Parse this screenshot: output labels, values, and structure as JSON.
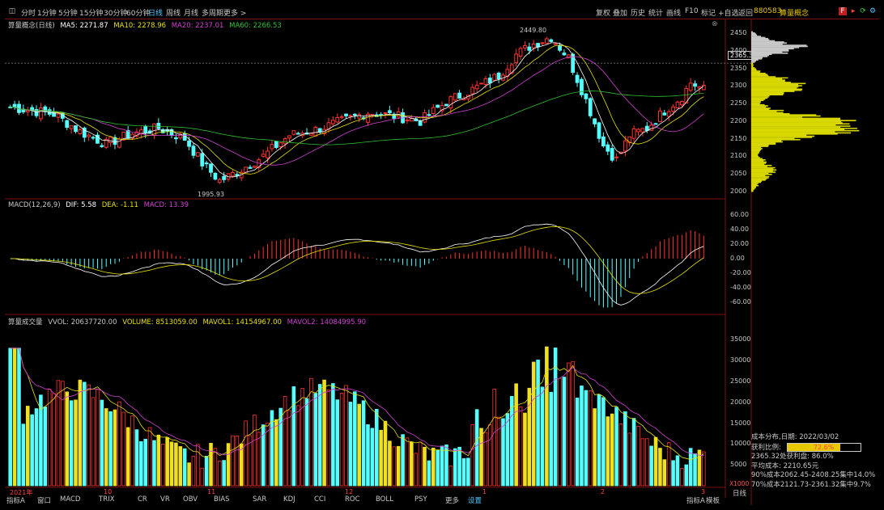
{
  "toolbar": {
    "periods": [
      "分时",
      "1分钟",
      "5分钟",
      "15分钟",
      "30分钟",
      "60分钟",
      "日线",
      "周线",
      "月线",
      "多周期",
      "更多 >"
    ],
    "active_period": "日线",
    "right_buttons": [
      "复权",
      "叠加",
      "历史",
      "统计",
      "画线",
      "F10",
      "标记",
      "+自选",
      "返回"
    ],
    "stock_code": "880583",
    "stock_name": "算量概念"
  },
  "main_chart": {
    "title": "算量概念(日线)",
    "ma5": "MA5: 2271.87",
    "ma10": "MA10: 2278.96",
    "ma20": "MA20: 2237.01",
    "ma60": "MA60: 2266.53",
    "high_label": "2449.80",
    "low_label": "1995.93",
    "current_price": "2365.3",
    "price_ticks": [
      "2450",
      "2400",
      "2350",
      "2300",
      "2250",
      "2200",
      "2150",
      "2100",
      "2050",
      "2000"
    ],
    "colors": {
      "up": "#ff3030",
      "down": "#54ffff",
      "ma5": "#ffffff",
      "ma10": "#e8e000",
      "ma20": "#d040d0",
      "ma60": "#30c030"
    }
  },
  "macd": {
    "title": "MACD(12,26,9)",
    "dif": "DIF: 5.58",
    "dea": "DEA: -1.11",
    "macd": "MACD: 13.39",
    "ticks": [
      "60.00",
      "40.00",
      "20.00",
      "0.00",
      "-20.00",
      "-40.00",
      "-60.00"
    ]
  },
  "volume": {
    "title": "算量成交量",
    "vvol": "VVOL: 20637720.00",
    "vol": "VOLUME: 8513059.00",
    "mavol1": "MAVOL1: 14154967.00",
    "mavol2": "MAVOL2: 14084995.90",
    "ticks": [
      "35000",
      "30000",
      "25000",
      "20000",
      "15000",
      "10000",
      "5000"
    ],
    "unit": "X1000"
  },
  "timeline": {
    "labels": [
      "2021年",
      "10",
      "11",
      "12",
      "1",
      "2",
      "3"
    ]
  },
  "indicator_tabs": [
    "指标A",
    "窗口",
    "MACD",
    "TRIX",
    "CR",
    "VR",
    "OBV",
    "BIAS",
    "SAR",
    "KDJ",
    "CCI",
    "ROC",
    "BOLL",
    "PSY",
    "更多",
    "设置"
  ],
  "bottom_right": {
    "left_text": "指标A",
    "right_text": "模板"
  },
  "period_button": "日线",
  "cost_distribution": {
    "title": "成本分布,日期: 2022/03/02",
    "profit_label": "获利比例:",
    "profit_value": "72.6%",
    "profit_fraction": 0.726,
    "line1": "2365.32处获利盘: 86.0%",
    "line2": "平均成本: 2210.65元",
    "line3": "90%成本2062.45-2408.25集中14.0%",
    "line4": "70%成本2121.73-2361.32集中9.7%"
  }
}
